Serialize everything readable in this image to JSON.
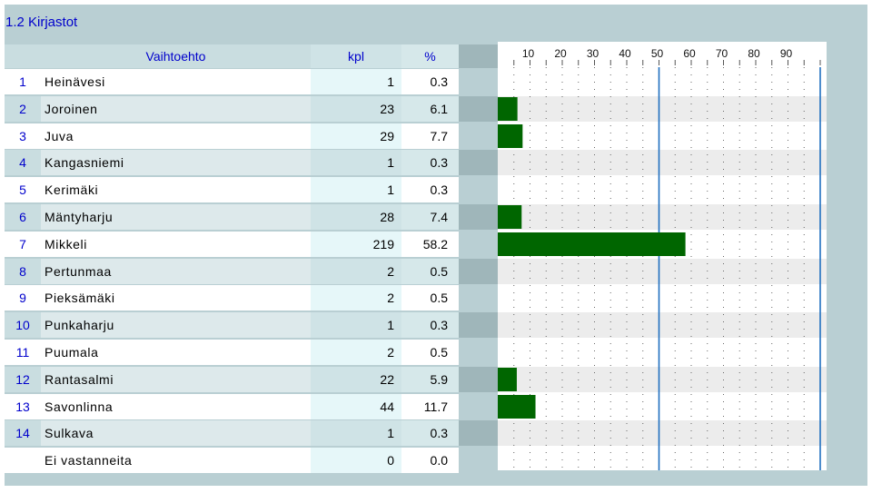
{
  "title": "1.2 Kirjastot",
  "header": {
    "option": "Vaihtoehto",
    "count": "kpl",
    "percent": "%"
  },
  "rows": [
    {
      "num": "1",
      "name": "Heinävesi",
      "count": "1",
      "percent": "0.3"
    },
    {
      "num": "2",
      "name": "Joroinen",
      "count": "23",
      "percent": "6.1"
    },
    {
      "num": "3",
      "name": "Juva",
      "count": "29",
      "percent": "7.7"
    },
    {
      "num": "4",
      "name": "Kangasniemi",
      "count": "1",
      "percent": "0.3"
    },
    {
      "num": "5",
      "name": "Kerimäki",
      "count": "1",
      "percent": "0.3"
    },
    {
      "num": "6",
      "name": "Mäntyharju",
      "count": "28",
      "percent": "7.4"
    },
    {
      "num": "7",
      "name": "Mikkeli",
      "count": "219",
      "percent": "58.2"
    },
    {
      "num": "8",
      "name": "Pertunmaa",
      "count": "2",
      "percent": "0.5"
    },
    {
      "num": "9",
      "name": "Pieksämäki",
      "count": "2",
      "percent": "0.5"
    },
    {
      "num": "10",
      "name": "Punkaharju",
      "count": "1",
      "percent": "0.3"
    },
    {
      "num": "11",
      "name": "Puumala",
      "count": "2",
      "percent": "0.5"
    },
    {
      "num": "12",
      "name": "Rantasalmi",
      "count": "22",
      "percent": "5.9"
    },
    {
      "num": "13",
      "name": "Savonlinna",
      "count": "44",
      "percent": "11.7"
    },
    {
      "num": "14",
      "name": "Sulkava",
      "count": "1",
      "percent": "0.3"
    },
    {
      "num": "",
      "name": "Ei vastanneita",
      "count": "0",
      "percent": "0.0"
    }
  ],
  "colors": {
    "frame": "#b9cfd3",
    "numColLight": "#ffffff",
    "numColDark": "#c9dde0",
    "rowLight": "#ffffff",
    "rowDark": "#dde9eb",
    "countColLight": "#e6f7f9",
    "countColDark": "#cfe3e6",
    "pctColLight": "#ffffff",
    "pctColDark": "#d6e8ea",
    "gapLight": "#b9cfd3",
    "gapDark": "#9fb6ba",
    "chartBandLight": "#ffffff",
    "chartBandDark": "#ececec",
    "bar": "#006600",
    "textBlue": "#0000cc",
    "grid": "#666666",
    "gridMajor": "#1f6fbf"
  },
  "chart_data": {
    "type": "bar",
    "orientation": "horizontal",
    "categories": [
      "Heinävesi",
      "Joroinen",
      "Juva",
      "Kangasniemi",
      "Kerimäki",
      "Mäntyharju",
      "Mikkeli",
      "Pertunmaa",
      "Pieksämäki",
      "Punkaharju",
      "Puumala",
      "Rantasalmi",
      "Savonlinna",
      "Sulkava",
      "Ei vastanneita"
    ],
    "values": [
      0.3,
      6.1,
      7.7,
      0.3,
      0.3,
      7.4,
      58.2,
      0.5,
      0.5,
      0.3,
      0.5,
      5.9,
      11.7,
      0.3,
      0.0
    ],
    "xticks": [
      "10",
      "20",
      "30",
      "40",
      "50",
      "60",
      "70",
      "80",
      "90"
    ],
    "xlim": [
      0,
      100
    ],
    "major_gridlines": [
      50,
      100
    ],
    "grid": true
  }
}
